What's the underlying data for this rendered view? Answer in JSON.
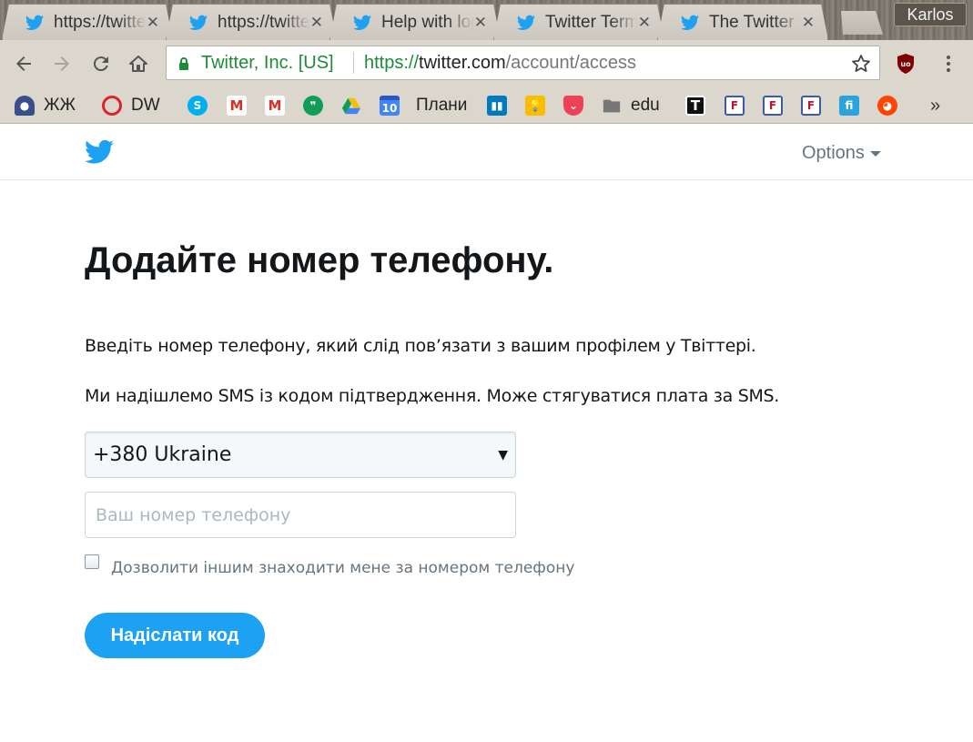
{
  "browser": {
    "tabs": [
      {
        "title": "https://twitter.com",
        "active": false
      },
      {
        "title": "https://twitter.com",
        "active": true
      },
      {
        "title": "Help with login",
        "active": false
      },
      {
        "title": "Twitter Terms",
        "active": false
      },
      {
        "title": "The Twitter",
        "active": false
      }
    ],
    "profile_name": "Karlos",
    "address_bar": {
      "ev_label": "Twitter, Inc. [US]",
      "url_scheme": "https://",
      "url_host": "twitter.com",
      "url_path": "/account/access"
    },
    "bookmarks": [
      {
        "label": "ЖЖ",
        "icon": "user-avatar-icon"
      },
      {
        "label": "DW",
        "icon": "dw-icon"
      },
      {
        "label": "",
        "icon": "skype-icon"
      },
      {
        "label": "",
        "icon": "gmail-icon"
      },
      {
        "label": "",
        "icon": "gmail-icon"
      },
      {
        "label": "",
        "icon": "hangouts-icon"
      },
      {
        "label": "",
        "icon": "drive-icon"
      },
      {
        "label": "Плани",
        "icon": "calendar-icon"
      },
      {
        "label": "",
        "icon": "trello-icon"
      },
      {
        "label": "",
        "icon": "keep-icon"
      },
      {
        "label": "",
        "icon": "pocket-icon"
      },
      {
        "label": "edu",
        "icon": "folder-icon"
      },
      {
        "label": "",
        "icon": "t-icon"
      },
      {
        "label": "",
        "icon": "feed-icon"
      },
      {
        "label": "",
        "icon": "feed-icon"
      },
      {
        "label": "",
        "icon": "feed-icon"
      },
      {
        "label": "",
        "icon": "fi-icon"
      },
      {
        "label": "",
        "icon": "reddit-icon"
      }
    ],
    "bookmarks_more": "»",
    "calendar_day": "10"
  },
  "page": {
    "options_label": "Options",
    "heading": "Додайте номер телефону.",
    "intro": "Введіть номер телефону, який слід пов’язати з вашим профілем у Твіттері.",
    "sms_note": "Ми надішлемо SMS із кодом підтвердження. Може стягуватися плата за SMS.",
    "country_select": "+380 Ukraine",
    "phone_placeholder": "Ваш номер телефону",
    "discoverability_label": "Дозволити іншим знаходити мене за номером телефону",
    "submit_label": "Надіслати код"
  },
  "colors": {
    "twitter_blue": "#1da1f2",
    "ev_green": "#1e8b3b",
    "chrome_frame": "#dcd7cd"
  }
}
